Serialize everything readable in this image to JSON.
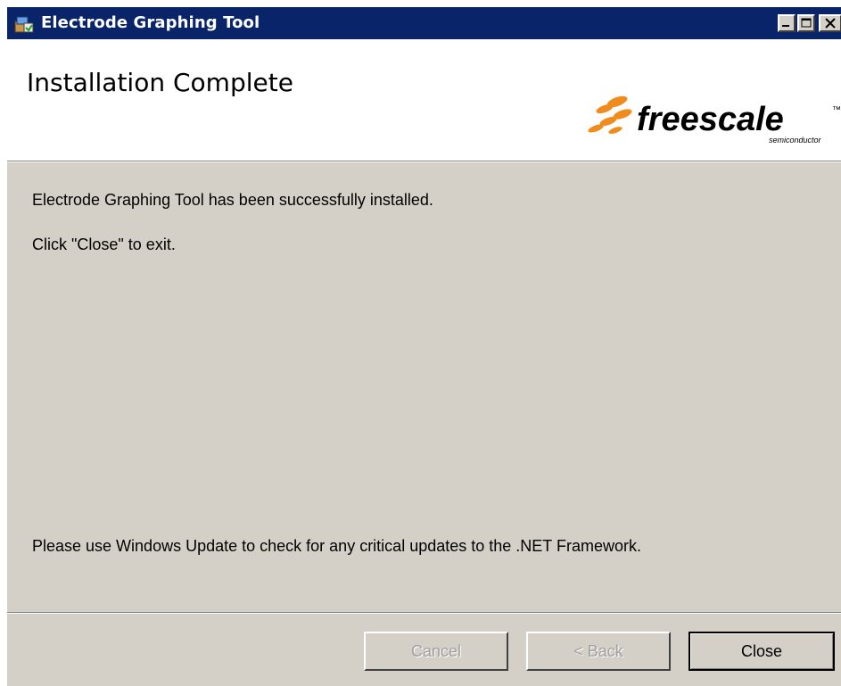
{
  "window": {
    "title": "Electrode Graphing Tool",
    "title_icon": "installer-package-icon",
    "controls": [
      "minimize-icon",
      "maximize-icon",
      "close-icon"
    ]
  },
  "banner": {
    "title": "Installation Complete",
    "logo": {
      "text": "freescale",
      "subtext": "semiconductor",
      "trademark": "™"
    }
  },
  "messages": {
    "success": "Electrode Graphing Tool has been successfully installed.",
    "instruction": "Click \"Close\" to exit.",
    "update_notice": "Please use Windows Update to check for any critical updates to the .NET Framework."
  },
  "buttons": {
    "cancel": "Cancel",
    "back": "< Back",
    "close": "Close"
  },
  "colors": {
    "titlebar": "#0a246a",
    "dialog": "#d4d0c8",
    "logo_orange": "#f08c1e"
  }
}
